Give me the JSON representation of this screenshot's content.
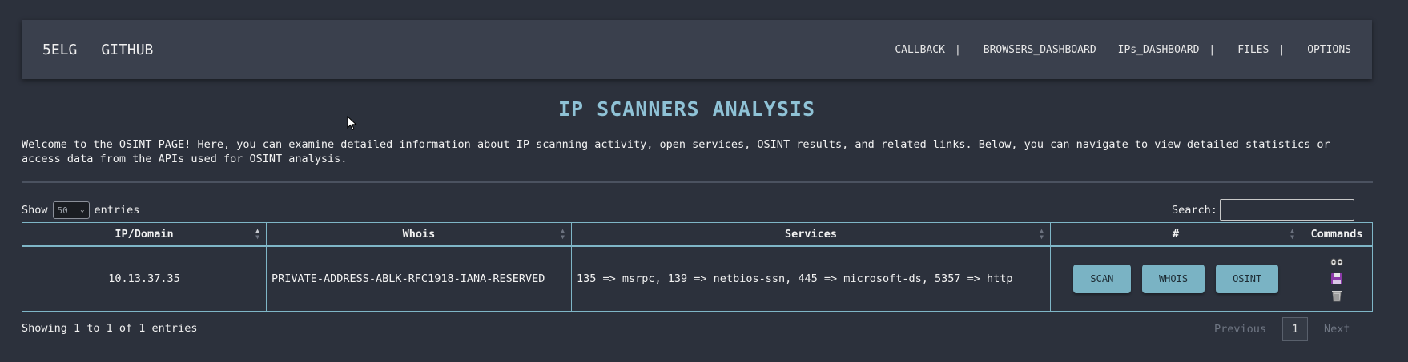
{
  "navbar": {
    "brand": [
      "5ELG",
      "GITHUB"
    ],
    "links": [
      {
        "label": "CALLBACK",
        "sep": "|"
      },
      {
        "label": "BROWSERS_DASHBOARD",
        "sep": ""
      },
      {
        "label": "IPs_DASHBOARD",
        "sep": "|"
      },
      {
        "label": "FILES",
        "sep": "|"
      },
      {
        "label": "OPTIONS",
        "sep": ""
      }
    ]
  },
  "page": {
    "title": "IP SCANNERS ANALYSIS",
    "intro": "Welcome to the OSINT PAGE! Here, you can examine detailed information about IP scanning activity, open services, OSINT results, and related links. Below, you can navigate to view detailed statistics or access data from the APIs used for OSINT analysis."
  },
  "table_controls": {
    "show_label": "Show",
    "entries_value": "50",
    "entries_label": "entries",
    "search_label": "Search:",
    "search_value": ""
  },
  "table": {
    "columns": [
      "IP/Domain",
      "Whois",
      "Services",
      "#",
      "Commands"
    ],
    "rows": [
      {
        "ip": "10.13.37.35",
        "whois": "PRIVATE-ADDRESS-ABLK-RFC1918-IANA-RESERVED",
        "services": "135 => msrpc, 139 => netbios-ssn, 445 => microsoft-ds, 5357 => http",
        "actions": [
          "SCAN",
          "WHOIS",
          "OSINT"
        ],
        "command_icons": [
          "view-icon",
          "save-icon",
          "trash-icon"
        ]
      }
    ]
  },
  "footer": {
    "info": "Showing 1 to 1 of 1 entries",
    "previous": "Previous",
    "page": "1",
    "next": "Next"
  },
  "colors": {
    "background": "#2c313c",
    "navbar": "#3a404d",
    "accent": "#8fc2d6",
    "button": "#7ab3c4",
    "table_border": "#7fb6c7"
  }
}
